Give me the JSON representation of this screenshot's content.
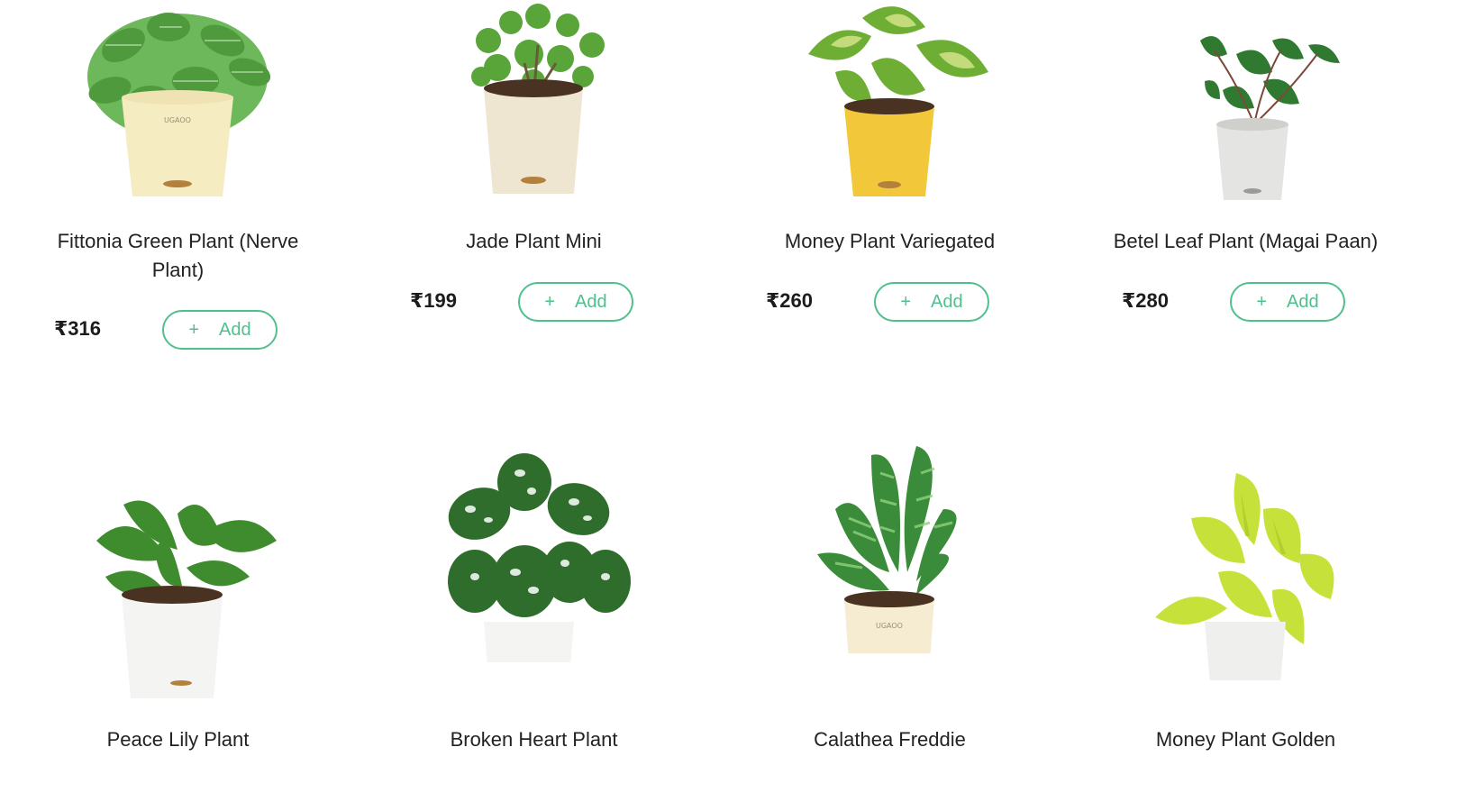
{
  "currency": "₹",
  "add_label": "Add",
  "plus_icon": "+",
  "products": [
    {
      "name": "Fittonia Green Plant (Nerve Plant)",
      "price": "₹316",
      "icon": "fittonia-plant-image",
      "pot_color": "#f6ecc2",
      "leaf_color": "#5bab4a"
    },
    {
      "name": "Jade Plant Mini",
      "price": "₹199",
      "icon": "jade-plant-image",
      "pot_color": "#efe6d2",
      "leaf_color": "#4e9a32"
    },
    {
      "name": "Money Plant Variegated",
      "price": "₹260",
      "icon": "money-plant-variegated-image",
      "pot_color": "#f2c83a",
      "leaf_color": "#5f9e2e"
    },
    {
      "name": "Betel Leaf Plant (Magai Paan)",
      "price": "₹280",
      "icon": "betel-leaf-plant-image",
      "pot_color": "#e4e4e2",
      "leaf_color": "#2f7a30"
    },
    {
      "name": "Peace Lily Plant",
      "price": "",
      "icon": "peace-lily-plant-image",
      "pot_color": "#f4f4f2",
      "leaf_color": "#3f8c2f"
    },
    {
      "name": "Broken Heart Plant",
      "price": "",
      "icon": "broken-heart-plant-image",
      "pot_color": "#f4f4f2",
      "leaf_color": "#2e6d2c"
    },
    {
      "name": "Calathea Freddie",
      "price": "",
      "icon": "calathea-freddie-plant-image",
      "pot_color": "#f6ecd2",
      "leaf_color": "#3a8b3a"
    },
    {
      "name": "Money Plant Golden",
      "price": "",
      "icon": "money-plant-golden-image",
      "pot_color": "#efefed",
      "leaf_color": "#c6e23a"
    }
  ],
  "pot_brand": "UGAOO"
}
